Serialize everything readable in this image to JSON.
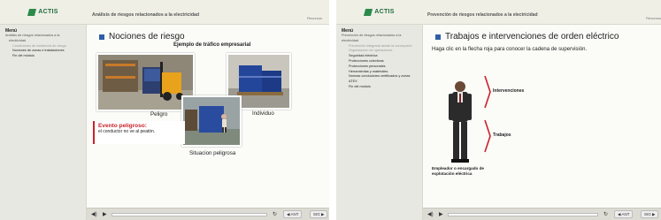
{
  "left": {
    "logo": "ACTIS",
    "course_title": "Análisis de riesgos relacionados a la electricidad",
    "recursos": "Recursos",
    "menu_title": "Menú",
    "menu_items": [
      "Análisis de riesgos relacionados a la",
      "electricidad",
      "Condiciones de existencia de riesgo",
      "Nociones de zonas e instalaciones",
      "Fin del módulo"
    ],
    "page_title": "Nociones de riesgo",
    "example_title": "Ejemplo de tráfico empresarial",
    "labels": {
      "peligro": "Peligro",
      "individuo": "Individuo",
      "situacion": "Situacion peligrosa"
    },
    "danger_title": "Evento peligroso:",
    "danger_text": "el conductor no ve al peatón.",
    "nav": {
      "ant": "◀ ANT",
      "sig": "SIG ▶"
    }
  },
  "right": {
    "logo": "ACTIS",
    "course_title": "Prevención de riesgos relacionados a la electricidad",
    "recursos": "Recursos",
    "menu_title": "Menú",
    "menu_items": [
      "Prevención de riesgos relacionados a la electricidad",
      "Prevención integrada desde la concepción",
      "Organización de operaciones",
      "Seguridad eléctrica",
      "Protecciones colectivas",
      "Protecciones personales",
      "Herramientas y materiales",
      "Normas conductores certificados y zonas ATEX",
      "Fin del módulo"
    ],
    "page_title": "Trabajos e intervenciones de orden eléctrico",
    "instruction": "Haga clic en la flecha roja para conocer la cadena de supervisión.",
    "arrows": [
      "Intervenciones",
      "Trabajos"
    ],
    "figure_caption": "Empleador o encargado de explotación eléctrica",
    "nav": {
      "ant": "◀ ANT",
      "sig": "SIG ▶"
    }
  },
  "colors": {
    "accent": "#2f5ea8",
    "danger": "#c9222a",
    "brand": "#2a8a4a"
  }
}
